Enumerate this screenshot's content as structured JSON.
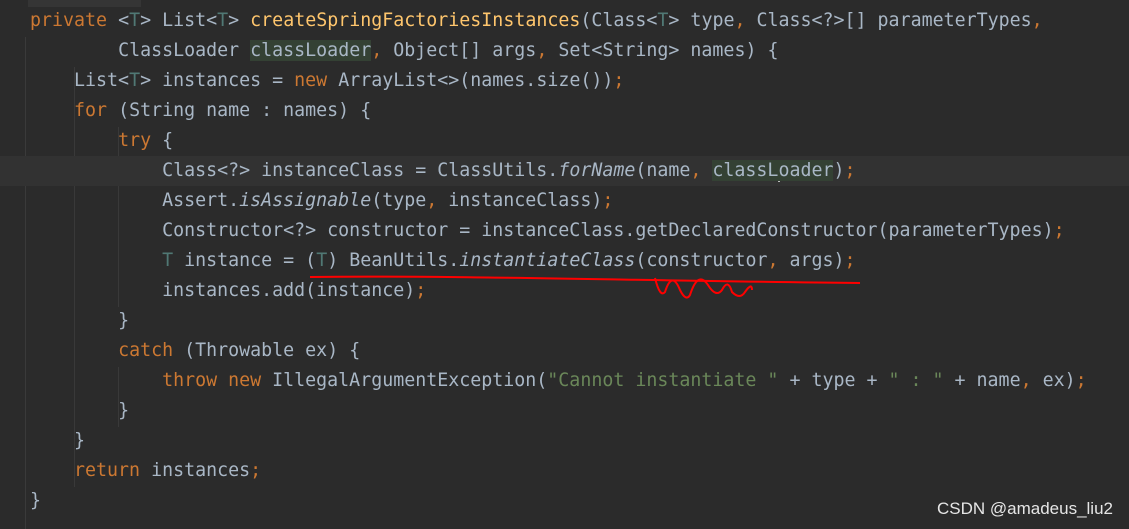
{
  "editor": {
    "current_line": 5,
    "lines": [
      {
        "indent": 0,
        "tokens": [
          [
            "private ",
            "k"
          ],
          [
            "<",
            ""
          ],
          [
            "T",
            "t"
          ],
          [
            "> List<",
            ""
          ],
          [
            "T",
            "t"
          ],
          [
            "> ",
            ""
          ],
          [
            "createSpringFactoriesInstances",
            "m"
          ],
          [
            "(Class<",
            ""
          ],
          [
            "T",
            "t"
          ],
          [
            "> type",
            ""
          ],
          [
            ", ",
            "k"
          ],
          [
            "Class<?>[] parameterTypes",
            ""
          ],
          [
            ",",
            "k"
          ]
        ]
      },
      {
        "indent": 8,
        "tokens": [
          [
            "ClassLoader ",
            ""
          ],
          [
            "classLoader",
            "h"
          ],
          [
            ", ",
            "k"
          ],
          [
            "Object[] args",
            ""
          ],
          [
            ", ",
            "k"
          ],
          [
            "Set<String> names) {",
            ""
          ]
        ]
      },
      {
        "indent": 4,
        "tokens": [
          [
            "List<",
            ""
          ],
          [
            "T",
            "t"
          ],
          [
            "> instances = ",
            ""
          ],
          [
            "new ",
            "k"
          ],
          [
            "ArrayList<>(names.size())",
            ""
          ],
          [
            ";",
            "k"
          ]
        ]
      },
      {
        "indent": 4,
        "tokens": [
          [
            "for ",
            "k"
          ],
          [
            "(String name : names) {",
            ""
          ]
        ]
      },
      {
        "indent": 8,
        "tokens": [
          [
            "try ",
            "k"
          ],
          [
            "{",
            ""
          ]
        ]
      },
      {
        "indent": 12,
        "tokens": [
          [
            "Class<?> instanceClass = ClassUtils.",
            ""
          ],
          [
            "forName",
            "i"
          ],
          [
            "(name",
            ""
          ],
          [
            ", ",
            "k"
          ],
          [
            "classL",
            "h"
          ],
          [
            "|caret",
            ""
          ],
          [
            "oader",
            "h"
          ],
          [
            ")",
            ""
          ],
          [
            ";",
            "k"
          ]
        ]
      },
      {
        "indent": 12,
        "tokens": [
          [
            "Assert.",
            ""
          ],
          [
            "isAssignable",
            "i"
          ],
          [
            "(type",
            ""
          ],
          [
            ", ",
            "k"
          ],
          [
            "instanceClass)",
            ""
          ],
          [
            ";",
            "k"
          ]
        ]
      },
      {
        "indent": 12,
        "tokens": [
          [
            "Constructor<?> constructor = instanceClass.getDeclaredConstructor(parameterTypes)",
            ""
          ],
          [
            ";",
            "k"
          ]
        ]
      },
      {
        "indent": 12,
        "tokens": [
          [
            "T",
            "t"
          ],
          [
            " instance = (",
            ""
          ],
          [
            "T",
            "t"
          ],
          [
            ") BeanUtils.",
            ""
          ],
          [
            "instantiateClass",
            "i"
          ],
          [
            "(constructor",
            ""
          ],
          [
            ", ",
            "k"
          ],
          [
            "args)",
            ""
          ],
          [
            ";",
            "k"
          ]
        ]
      },
      {
        "indent": 12,
        "tokens": [
          [
            "instances.add(instance)",
            ""
          ],
          [
            ";",
            "k"
          ]
        ]
      },
      {
        "indent": 8,
        "tokens": [
          [
            "}",
            ""
          ]
        ]
      },
      {
        "indent": 8,
        "tokens": [
          [
            "catch ",
            "k"
          ],
          [
            "(Throwable ex) {",
            ""
          ]
        ]
      },
      {
        "indent": 12,
        "tokens": [
          [
            "throw new ",
            "k"
          ],
          [
            "IllegalArgumentException(",
            ""
          ],
          [
            "\"Cannot instantiate \"",
            "s"
          ],
          [
            " + type + ",
            ""
          ],
          [
            "\" : \"",
            "s"
          ],
          [
            " + name",
            ""
          ],
          [
            ", ",
            "k"
          ],
          [
            "ex)",
            ""
          ],
          [
            ";",
            "k"
          ]
        ]
      },
      {
        "indent": 8,
        "tokens": [
          [
            "}",
            ""
          ]
        ]
      },
      {
        "indent": 4,
        "tokens": [
          [
            "}",
            ""
          ]
        ]
      },
      {
        "indent": 4,
        "tokens": [
          [
            "return ",
            "k"
          ],
          [
            "instances",
            ""
          ],
          [
            ";",
            "k"
          ]
        ]
      },
      {
        "indent": 0,
        "tokens": [
          [
            "}",
            ""
          ]
        ]
      }
    ]
  },
  "colors": {
    "background": "#2b2b2b",
    "text": "#a9b7c6",
    "keyword": "#cc7832",
    "method_declaration": "#ffc66d",
    "type_parameter": "#507874",
    "string": "#6a8759",
    "annotation_ink": "#ff0000"
  },
  "watermark": "CSDN @amadeus_liu2"
}
